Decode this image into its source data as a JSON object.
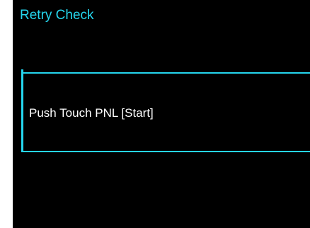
{
  "screen": {
    "title": "Retry Check",
    "message": "Push Touch PNL [Start]"
  },
  "colors": {
    "accent": "#25d6ee",
    "background": "#000000",
    "text": "#ffffff"
  }
}
